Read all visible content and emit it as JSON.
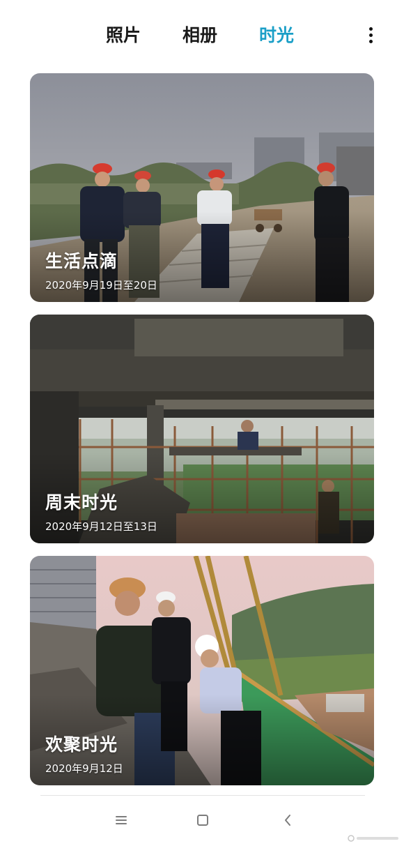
{
  "tabs": [
    {
      "label": "照片",
      "active": false
    },
    {
      "label": "相册",
      "active": false
    },
    {
      "label": "时光",
      "active": true
    }
  ],
  "accent_color": "#1b9fc7",
  "more_icon": "more-vertical-icon",
  "moments": [
    {
      "title": "生活点滴",
      "date": "2020年9月19日至20日"
    },
    {
      "title": "周末时光",
      "date": "2020年9月12日至13日"
    },
    {
      "title": "欢聚时光",
      "date": "2020年9月12日"
    }
  ],
  "navbar": {
    "icons": [
      "menu-icon",
      "home-icon",
      "back-icon"
    ]
  }
}
